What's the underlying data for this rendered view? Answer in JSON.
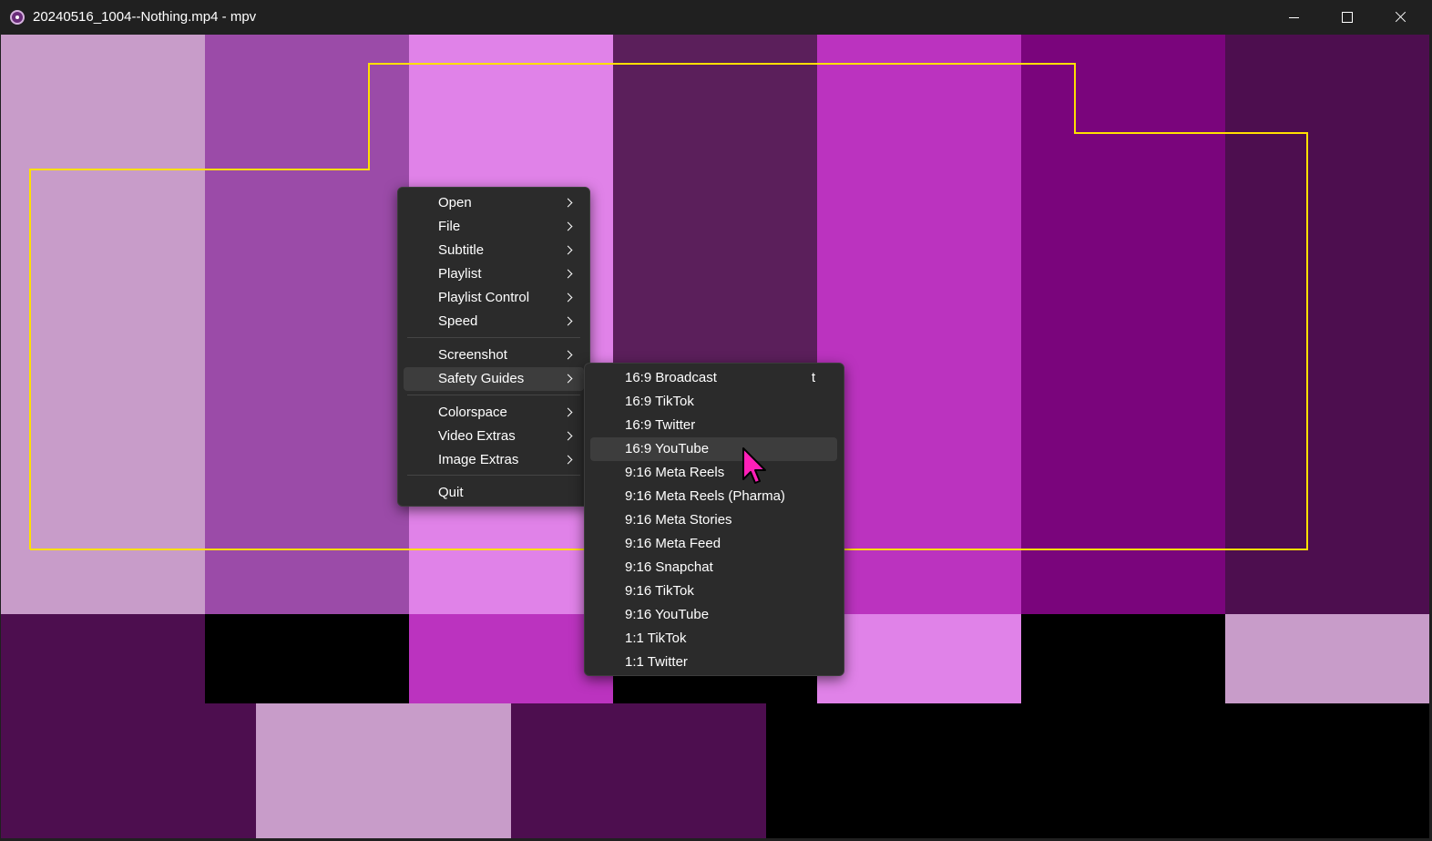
{
  "window": {
    "title": "20240516_1004--Nothing.mp4 - mpv",
    "app_icon": "mpv-icon",
    "controls": [
      "minimize-icon",
      "maximize-icon",
      "close-icon"
    ]
  },
  "colors": {
    "bars": [
      "#c89cc9",
      "#9b4ba8",
      "#e082e8",
      "#5b1f5b",
      "#bb33bf",
      "#7a057c",
      "#4d0e4f",
      "#e082e8",
      "#000000"
    ],
    "guide": "#ffe000",
    "cursor": "#ff1fb8"
  },
  "main_menu": [
    {
      "label": "Open",
      "submenu": true
    },
    {
      "label": "File",
      "submenu": true
    },
    {
      "label": "Subtitle",
      "submenu": true
    },
    {
      "label": "Playlist",
      "submenu": true
    },
    {
      "label": "Playlist Control",
      "submenu": true
    },
    {
      "label": "Speed",
      "submenu": true
    },
    {
      "label": "Screenshot",
      "submenu": true
    },
    {
      "label": "Safety Guides",
      "submenu": true,
      "highlighted": true
    },
    {
      "label": "Colorspace",
      "submenu": true
    },
    {
      "label": "Video Extras",
      "submenu": true
    },
    {
      "label": "Image Extras",
      "submenu": true
    },
    {
      "label": "Quit",
      "submenu": false
    }
  ],
  "safety_guides_menu": [
    {
      "label": "16:9 Broadcast",
      "shortcut": "t"
    },
    {
      "label": "16:9 TikTok"
    },
    {
      "label": "16:9 Twitter"
    },
    {
      "label": "16:9 YouTube",
      "hovered": true
    },
    {
      "label": "9:16 Meta Reels"
    },
    {
      "label": "9:16 Meta Reels (Pharma)"
    },
    {
      "label": "9:16 Meta Stories"
    },
    {
      "label": "9:16 Meta Feed"
    },
    {
      "label": "9:16 Snapchat"
    },
    {
      "label": "9:16 TikTok"
    },
    {
      "label": "9:16 YouTube"
    },
    {
      "label": "1:1 TikTok"
    },
    {
      "label": "1:1 Twitter"
    }
  ]
}
